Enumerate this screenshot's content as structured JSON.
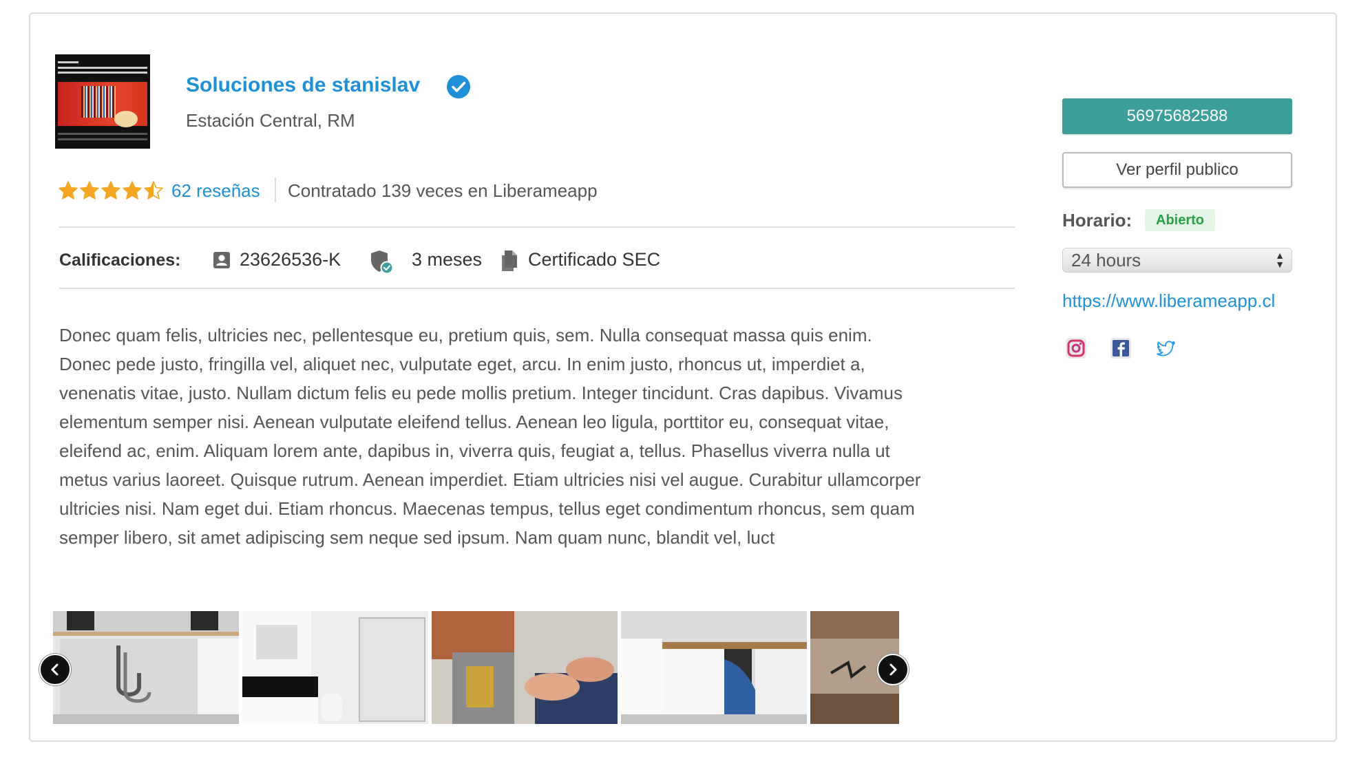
{
  "business": {
    "name": "Soluciones de stanislav",
    "location": "Estación Central, RM",
    "rating": 4.5,
    "rating_max": 5,
    "reviews_label": "62 reseñas",
    "hired_label": "Contratado 139 veces en Liberameapp"
  },
  "calificaciones": {
    "label": "Calificaciones:",
    "rut": "23626536-K",
    "tenure": "3 meses",
    "certificate": "Certificado SEC"
  },
  "description": "Donec quam felis, ultricies nec, pellentesque eu, pretium quis, sem. Nulla consequat massa quis enim. Donec pede justo, fringilla vel, aliquet nec, vulputate eget, arcu. In enim justo, rhoncus ut, imperdiet a, venenatis vitae, justo. Nullam dictum felis eu pede mollis pretium. Integer tincidunt. Cras dapibus. Vivamus elementum semper nisi. Aenean vulputate eleifend tellus. Aenean leo ligula, porttitor eu, consequat vitae, eleifend ac, enim. Aliquam lorem ante, dapibus in, viverra quis, feugiat a, tellus. Phasellus viverra nulla ut metus varius laoreet. Quisque rutrum. Aenean imperdiet. Etiam ultricies nisi vel augue. Curabitur ullamcorper ultricies nisi. Nam eget dui. Etiam rhoncus. Maecenas tempus, tellus eget condimentum rhoncus, sem quam semper libero, sit amet adipiscing sem neque sed ipsum. Nam quam nunc, blandit vel, luct",
  "gallery": {
    "images": [
      "sink-cabinet-photo",
      "bathroom-shower-photo",
      "water-heater-repair-photo",
      "plumber-under-sink-photo",
      "pipe-closeup-photo"
    ],
    "prev_icon": "chevron-left-icon",
    "next_icon": "chevron-right-icon"
  },
  "sidebar": {
    "phone": "56975682588",
    "profile_button": "Ver perfil publico",
    "horario_label": "Horario:",
    "status": "Abierto",
    "schedule_value": "24 hours",
    "website": "https://www.liberameapp.cl",
    "social": [
      "instagram-icon",
      "facebook-icon",
      "twitter-icon"
    ]
  },
  "colors": {
    "brand_blue": "#1e90d8",
    "teal": "#3d9f9b",
    "star": "#f5a623",
    "open_green": "#25a244"
  }
}
